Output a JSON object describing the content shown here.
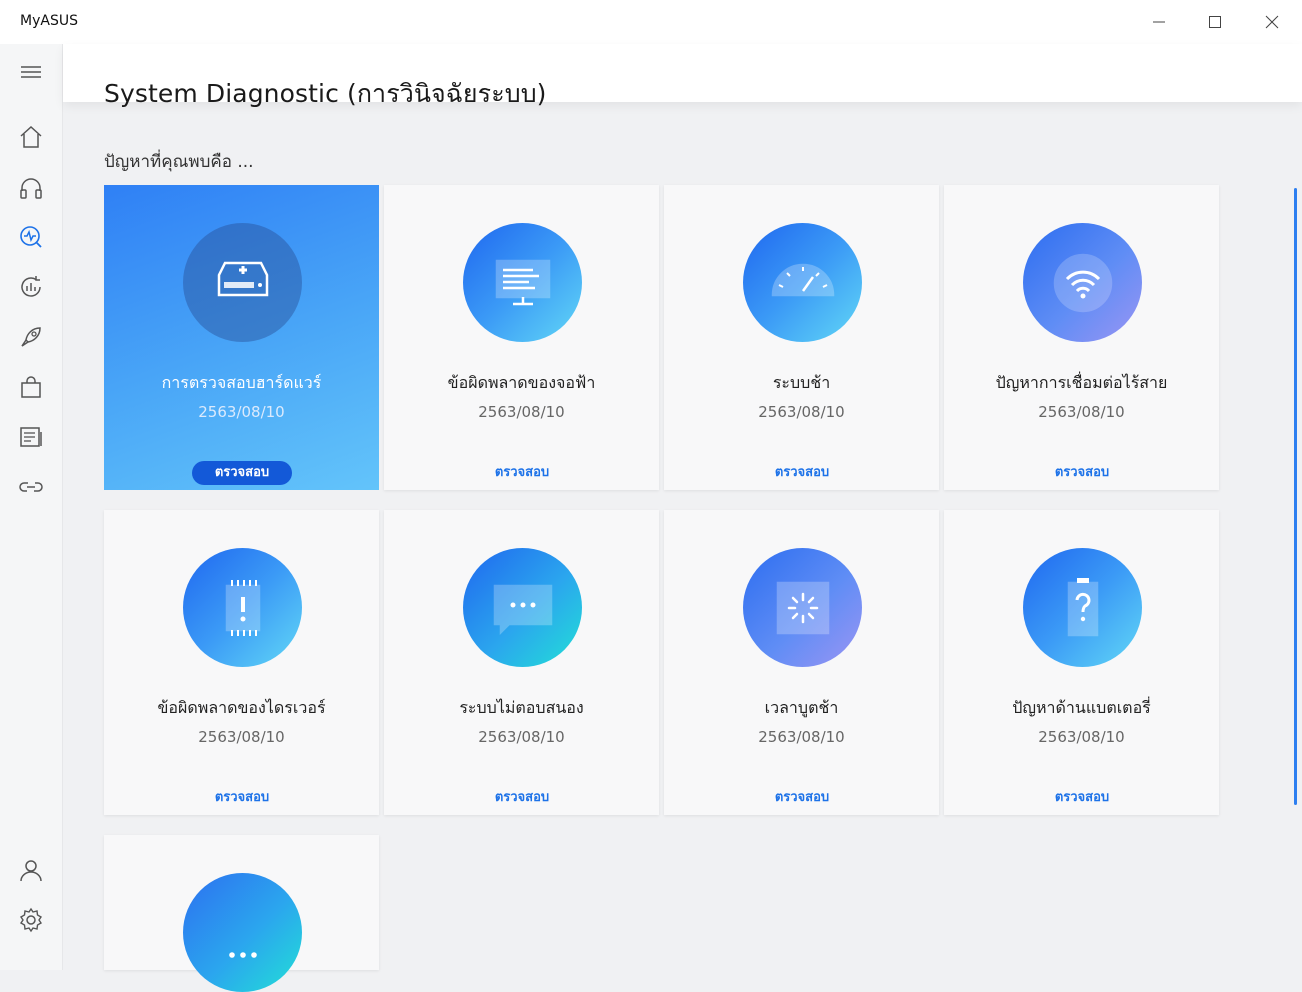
{
  "app": {
    "title": "MyASUS"
  },
  "header": {
    "title": "System Diagnostic (การวินิจฉัยระบบ)"
  },
  "prompt": "ปัญหาที่คุณพบคือ ...",
  "action_label": "ตรวจสอบ",
  "cards": [
    {
      "label": "การตรวจสอบฮาร์ดแวร์",
      "date": "2563/08/10",
      "icon": "hardware-drive-icon",
      "selected": true
    },
    {
      "label": "ข้อผิดพลาดของจอฟ้า",
      "date": "2563/08/10",
      "icon": "blue-screen-icon"
    },
    {
      "label": "ระบบช้า",
      "date": "2563/08/10",
      "icon": "speedometer-icon"
    },
    {
      "label": "ปัญหาการเชื่อมต่อไร้สาย",
      "date": "2563/08/10",
      "icon": "wifi-icon"
    },
    {
      "label": "ข้อผิดพลาดของไดรเวอร์",
      "date": "2563/08/10",
      "icon": "driver-chip-icon"
    },
    {
      "label": "ระบบไม่ตอบสนอง",
      "date": "2563/08/10",
      "icon": "unresponsive-chat-icon"
    },
    {
      "label": "เวลาบูตช้า",
      "date": "2563/08/10",
      "icon": "boot-loading-icon"
    },
    {
      "label": "ปัญหาด้านแบตเตอรี่",
      "date": "2563/08/10",
      "icon": "battery-question-icon"
    },
    {
      "label": "",
      "date": "",
      "icon": "more-icon"
    }
  ],
  "sidebar": {
    "items": [
      {
        "icon": "home-icon"
      },
      {
        "icon": "headset-icon"
      },
      {
        "icon": "diagnostic-icon",
        "selected": true
      },
      {
        "icon": "update-icon"
      },
      {
        "icon": "rocket-icon"
      },
      {
        "icon": "shopping-bag-icon"
      },
      {
        "icon": "news-icon"
      },
      {
        "icon": "link-icon"
      }
    ],
    "bottom": [
      {
        "icon": "user-icon"
      },
      {
        "icon": "settings-icon"
      }
    ]
  },
  "colors": {
    "accent": "#1d72e8",
    "selected_card": "#3d95f6",
    "circle_start": "#1f67ef",
    "circle_end": "#62d8f6"
  }
}
